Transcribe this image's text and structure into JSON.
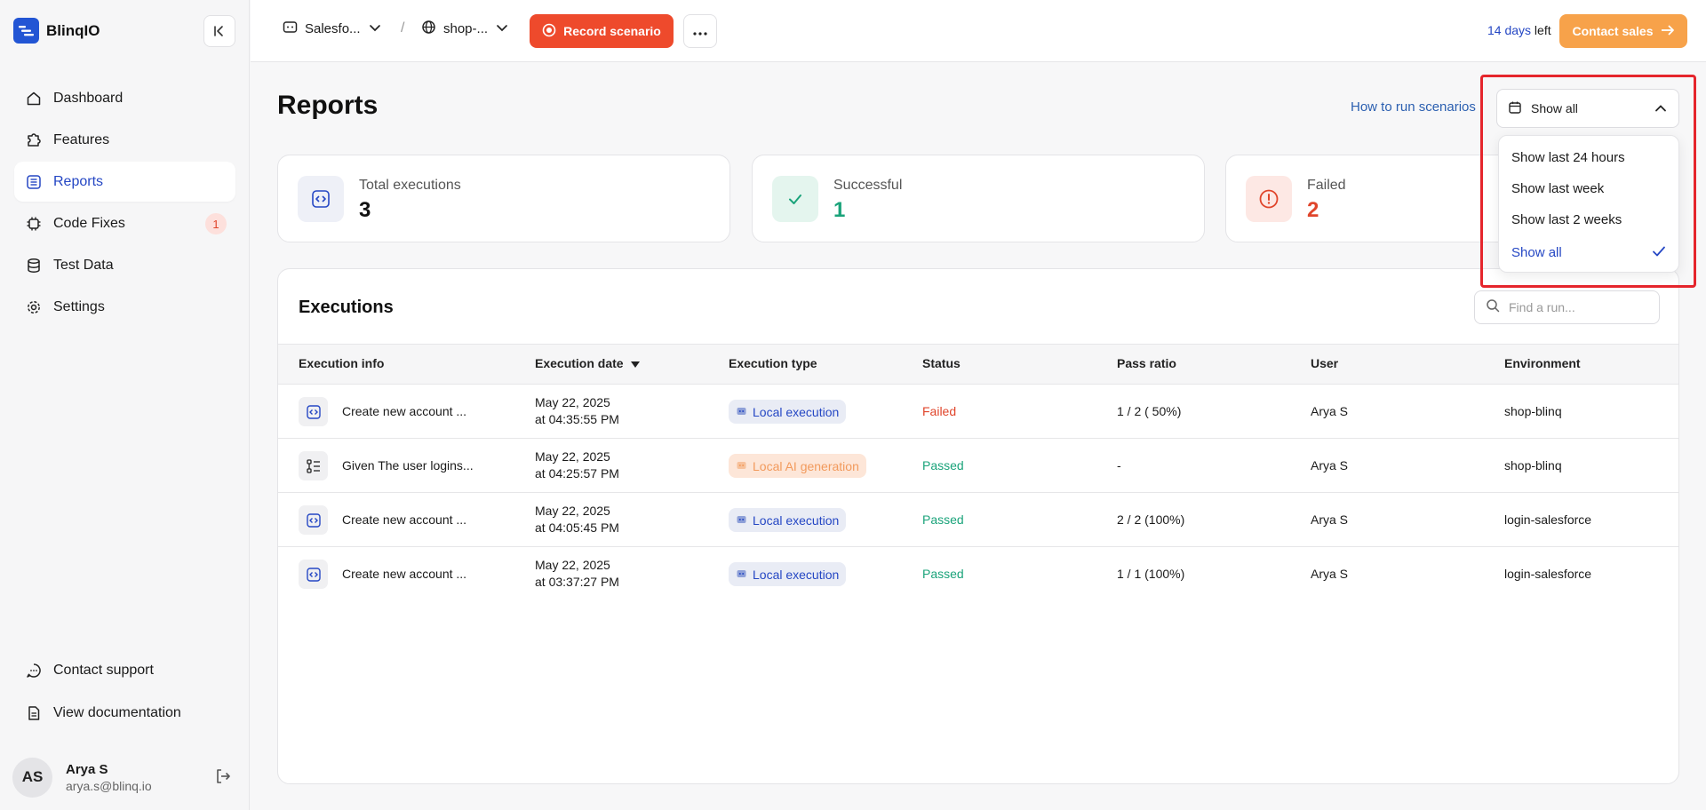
{
  "brand": {
    "name": "BlinqIO"
  },
  "sidebar": {
    "items": [
      {
        "label": "Dashboard",
        "icon": "home-icon"
      },
      {
        "label": "Features",
        "icon": "puzzle-icon"
      },
      {
        "label": "Reports",
        "icon": "list-icon",
        "active": true
      },
      {
        "label": "Code Fixes",
        "icon": "cpu-icon",
        "badge": "1"
      },
      {
        "label": "Test Data",
        "icon": "database-icon"
      },
      {
        "label": "Settings",
        "icon": "gear-icon"
      }
    ],
    "bottom": [
      {
        "label": "Contact support",
        "icon": "chat-icon"
      },
      {
        "label": "View documentation",
        "icon": "document-icon"
      }
    ]
  },
  "user": {
    "initials": "AS",
    "name": "Arya S",
    "email": "arya.s@blinq.io"
  },
  "topbar": {
    "project": "Salesfo...",
    "environment": "shop-...",
    "separator": "/",
    "record_label": "Record scenario",
    "trial_days": "14 days",
    "trial_suffix": " left",
    "contact_label": "Contact sales"
  },
  "page": {
    "title": "Reports",
    "how_link": "How to run scenarios",
    "filter_label": "Show all"
  },
  "stats": [
    {
      "label": "Total executions",
      "value": "3",
      "color": "#111111"
    },
    {
      "label": "Successful",
      "value": "1",
      "color": "#1aa37a"
    },
    {
      "label": "Failed",
      "value": "2",
      "color": "#e0452b"
    }
  ],
  "executions": {
    "title": "Executions",
    "search_placeholder": "Find a run...",
    "columns": [
      "Execution info",
      "Execution date",
      "Execution type",
      "Status",
      "Pass ratio",
      "User",
      "Environment"
    ],
    "rows": [
      {
        "info": "Create new account ...",
        "date": "May 22, 2025",
        "time": "at 04:35:55 PM",
        "type": "Local execution",
        "type_kind": "local",
        "status": "Failed",
        "ratio": "1 / 2 ( 50%)",
        "user": "Arya S",
        "env": "shop-blinq"
      },
      {
        "info": "Given The user logins...",
        "date": "May 22, 2025",
        "time": "at 04:25:57 PM",
        "type": "Local AI generation",
        "type_kind": "ai",
        "status": "Passed",
        "ratio": "-",
        "user": "Arya S",
        "env": "shop-blinq"
      },
      {
        "info": "Create new account ...",
        "date": "May 22, 2025",
        "time": "at 04:05:45 PM",
        "type": "Local execution",
        "type_kind": "local",
        "status": "Passed",
        "ratio": "2 / 2 (100%)",
        "user": "Arya S",
        "env": "login-salesforce"
      },
      {
        "info": "Create new account ...",
        "date": "May 22, 2025",
        "time": "at 03:37:27 PM",
        "type": "Local execution",
        "type_kind": "local",
        "status": "Passed",
        "ratio": "1 / 1 (100%)",
        "user": "Arya S",
        "env": "login-salesforce"
      }
    ]
  },
  "dropdown": {
    "options": [
      "Show last 24 hours",
      "Show last week",
      "Show last 2 weeks",
      "Show all"
    ],
    "selected": "Show all"
  },
  "colors": {
    "accent": "#2547c4",
    "record": "#ee4a2c",
    "contact": "#f7a24a",
    "highlight": "#e5252c"
  }
}
